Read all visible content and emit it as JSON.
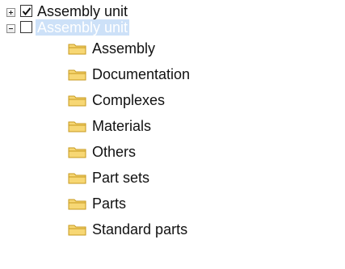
{
  "tree": {
    "nodes": [
      {
        "label": "Assembly unit",
        "expanded": false,
        "checked": true,
        "selected": false
      },
      {
        "label": "Assembly unit",
        "expanded": true,
        "checked": false,
        "selected": true,
        "children": [
          "Assembly",
          "Documentation",
          "Complexes",
          "Materials",
          "Others",
          "Part sets",
          "Parts",
          "Standard parts"
        ]
      }
    ]
  },
  "colors": {
    "selection_background": "#cde1f8",
    "folder_fill": "#f7d774",
    "folder_stroke": "#c79a1e"
  },
  "icons": {
    "expander_plus": "plus-box-icon",
    "expander_minus": "minus-box-icon",
    "folder": "folder-icon",
    "checkmark": "checkmark-icon"
  }
}
